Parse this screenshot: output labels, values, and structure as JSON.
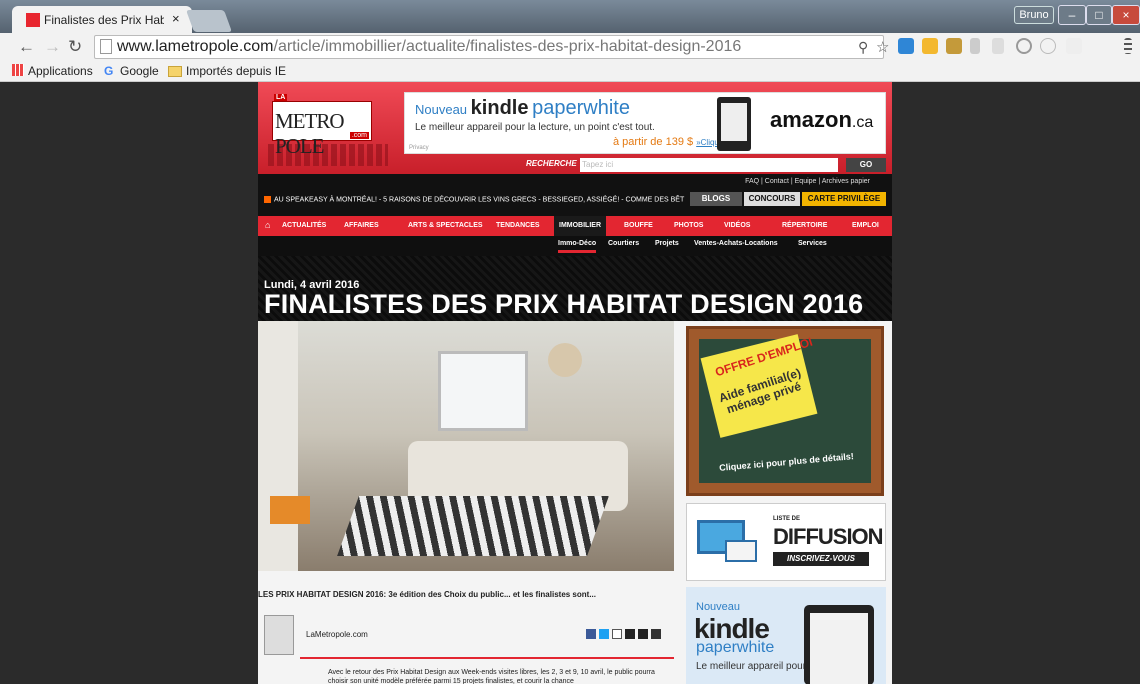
{
  "browser": {
    "tab_title": "Finalistes des Prix Habitat",
    "tab_close": "×",
    "user": "Bruno",
    "url_host": "www.lametropole.com",
    "url_path": "/article/immobillier/actualite/finalistes-des-prix-habitat-design-2016",
    "bookmarks": {
      "apps": "Applications",
      "google": "Google",
      "imported": "Importés depuis IE"
    }
  },
  "site": {
    "logo_la": "LA",
    "logo_name": "METRO POLE",
    "logo_com": ".com",
    "ad_top": {
      "nouveau": "Nouveau",
      "kindle": "kindle",
      "pw": "paperwhite",
      "line2": "Le meilleur appareil pour la lecture, un point c'est tout.",
      "price": "à partir de 139 $",
      "cta": "»Cliquez ici",
      "privacy": "Privacy",
      "brand": "amazon",
      "brand_tld": ".ca"
    },
    "search": {
      "label": "RECHERCHE",
      "placeholder": "Tapez ici",
      "go": "GO"
    },
    "top_links": "FAQ | Contact | Equipe | Archives papier",
    "ticker": "AU SPEAKEASY À MONTRÉAL! - 5 RAISONS DE DÉCOUVRIR LES VINS GRECS - BESSIEGED, ASSIÉGÉ! - COMME DES BÊT",
    "top_buttons": {
      "blogs": "BLOGS",
      "concours": "CONCOURS",
      "carte": "CARTE PRIVILÈGE"
    },
    "nav": [
      "ACTUALITÉS",
      "AFFAIRES",
      "ARTS & SPECTACLES",
      "TENDANCES",
      "IMMOBILIER",
      "BOUFFE",
      "PHOTOS",
      "VIDÉOS",
      "RÉPERTOIRE",
      "EMPLOI"
    ],
    "subnav": [
      "Immo-Déco",
      "Courtiers",
      "Projets",
      "Ventes-Achats-Locations",
      "Services"
    ]
  },
  "article": {
    "date": "Lundi, 4 avril 2016",
    "headline": "FINALISTES DES PRIX HABITAT DESIGN 2016",
    "caption": "LES PRIX HABITAT DESIGN 2016: 3e édition des Choix du public... et les finalistes sont...",
    "author": "LaMetropole.com",
    "body": "Avec le retour des Prix Habitat Design aux Week-ends visites libres, les 2, 3 et 9, 10 avril, le public pourra choisir son unité modèle préférée parmi 15 projets finalistes, et courir la chance"
  },
  "sidebar": {
    "job": {
      "offre": "OFFRE D'EMPLOI",
      "aide": "Aide familial(e) ménage privé",
      "click": "Cliquez ici pour plus de détails!"
    },
    "diffusion": {
      "liste": "LISTE DE",
      "title": "DIFFUSION",
      "cta": "INSCRIVEZ-VOUS"
    },
    "kindle": {
      "nouveau": "Nouveau",
      "kindle": "kindle",
      "pw": "paperwhite",
      "line": "Le meilleur appareil pour la lecture."
    }
  },
  "colors": {
    "brand_red": "#e32631",
    "dark": "#111111",
    "chrome": "#f2f2f2"
  }
}
